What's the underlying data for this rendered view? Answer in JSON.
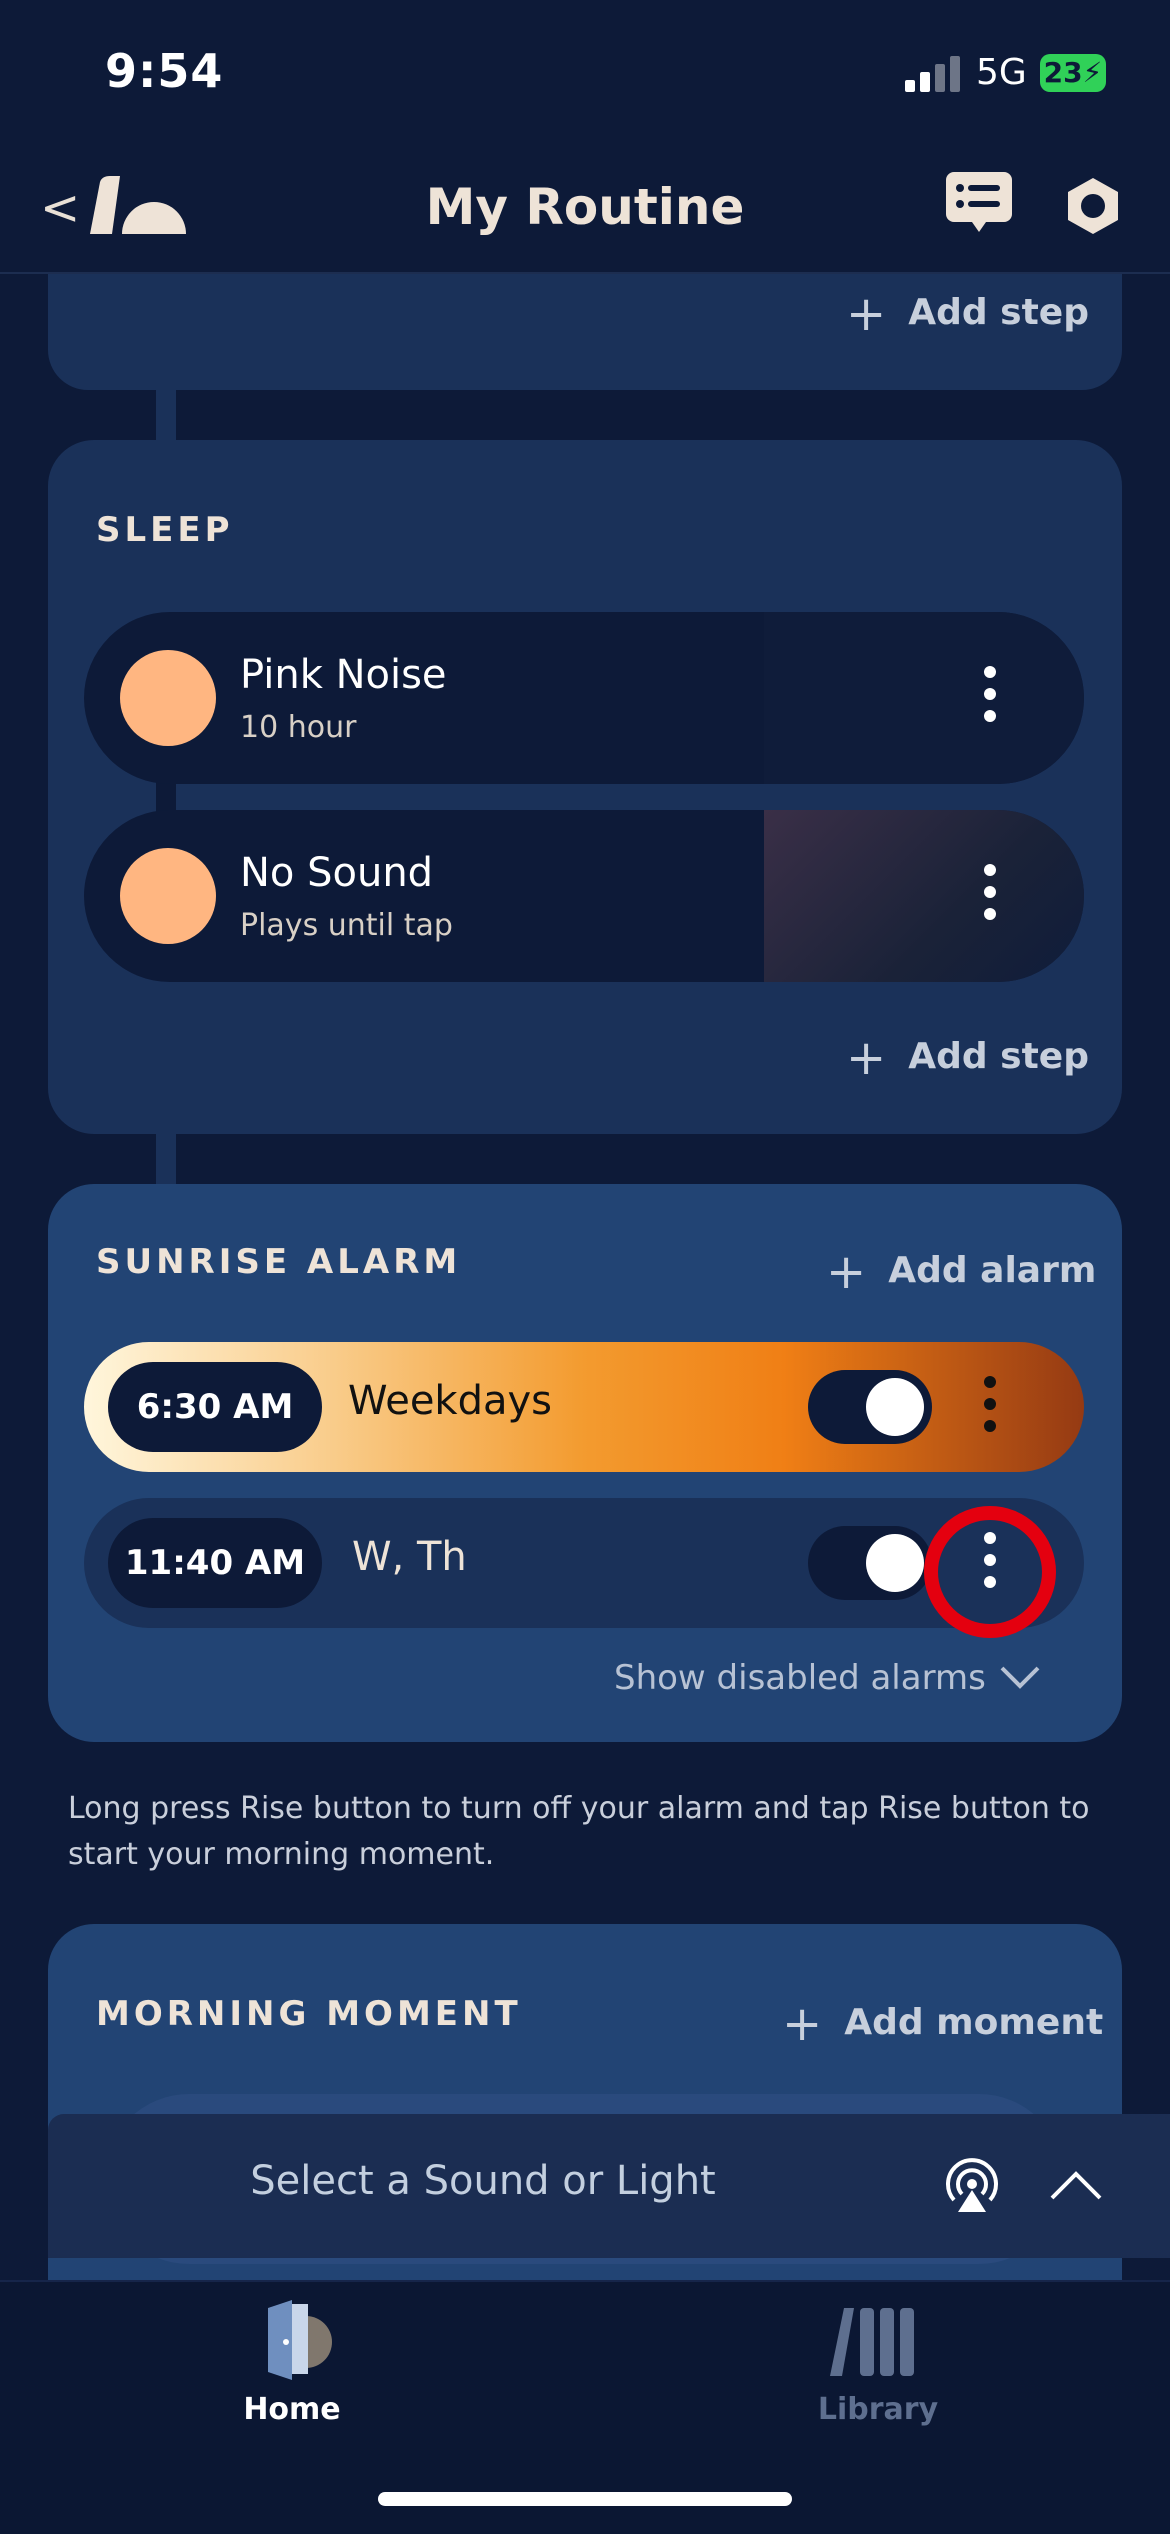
{
  "status_bar": {
    "time": "9:54",
    "network": "5G",
    "battery": "23"
  },
  "header": {
    "title": "My Routine"
  },
  "top_card": {
    "add_label": "Add step"
  },
  "sleep": {
    "label": "SLEEP",
    "steps": [
      {
        "name": "Pink Noise",
        "sub": "10 hour"
      },
      {
        "name": "No Sound",
        "sub": "Plays until tap"
      }
    ],
    "add_label": "Add step"
  },
  "alarm": {
    "label": "SUNRISE ALARM",
    "add_label": "Add alarm",
    "items": [
      {
        "time": "6:30 AM",
        "days": "Weekdays"
      },
      {
        "time": "11:40 AM",
        "days": "W, Th"
      }
    ],
    "show_disabled": "Show disabled alarms"
  },
  "note": "Long press Rise button to turn off your alarm and tap Rise button to start your morning moment.",
  "morning": {
    "label": "MORNING MOMENT",
    "add_label": "Add moment"
  },
  "player": {
    "label": "Select a Sound or Light"
  },
  "tabs": [
    {
      "label": "Home"
    },
    {
      "label": "Library"
    }
  ],
  "colors": {
    "accent_peach": "#ffb681",
    "highlight": "#e4000f",
    "background": "#0d1a38"
  }
}
